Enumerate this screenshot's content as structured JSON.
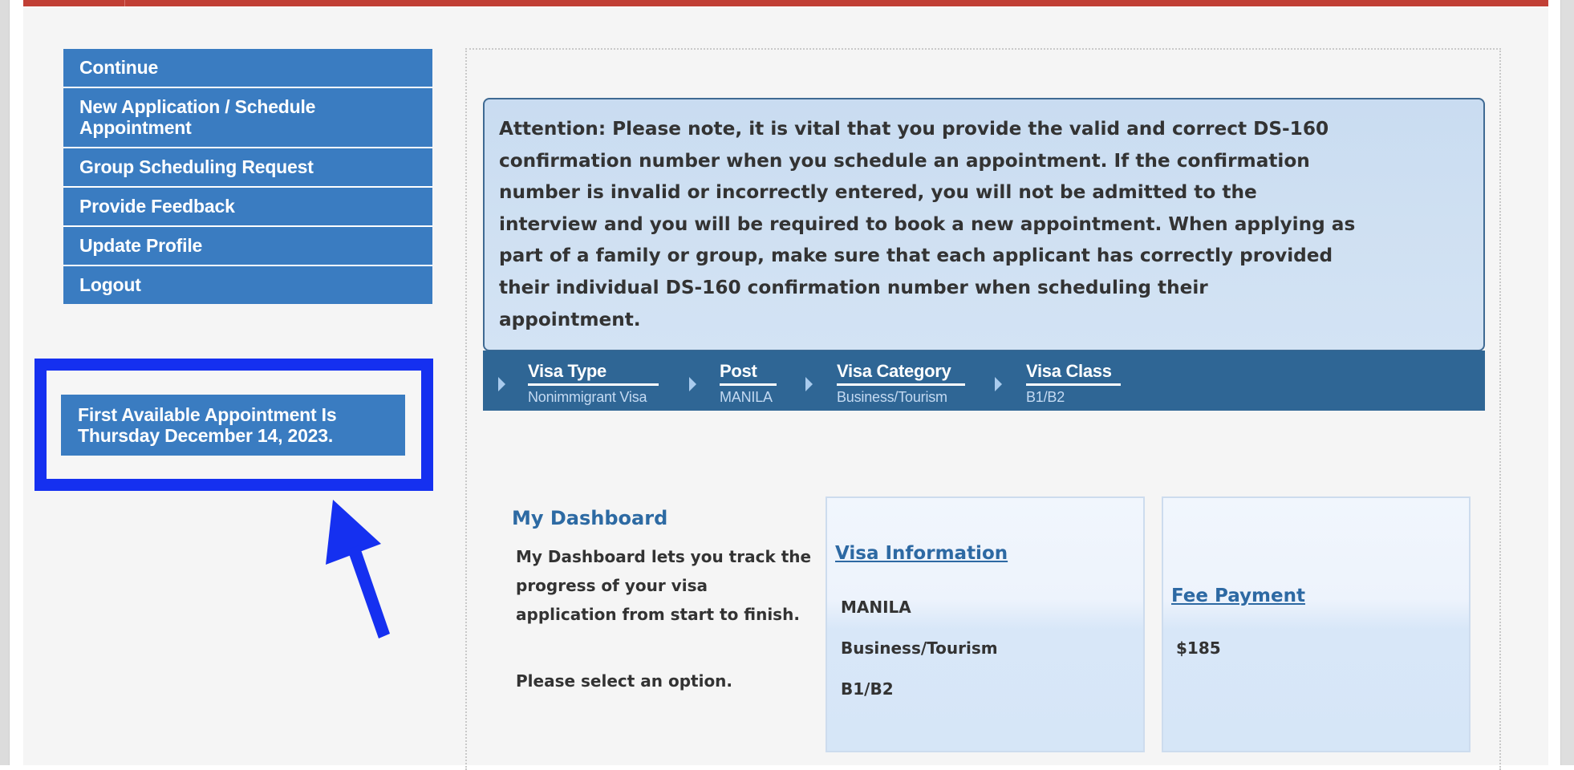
{
  "menu": {
    "items": [
      {
        "label": "Continue"
      },
      {
        "label": "New Application / Schedule Appointment"
      },
      {
        "label": "Group Scheduling Request"
      },
      {
        "label": "Provide Feedback"
      },
      {
        "label": "Update Profile"
      },
      {
        "label": "Logout"
      }
    ]
  },
  "appointment": {
    "line1": "First Available Appointment Is",
    "line2": "Thursday December 14, 2023."
  },
  "annotation": {
    "highlight_color": "#1530f0",
    "arrow_icon": "arrow-up-left-icon"
  },
  "attention": {
    "lines": [
      "Attention: Please note, it is vital that you provide the valid and correct DS-160",
      "confirmation number when you schedule an appointment. If the confirmation",
      "number is invalid or incorrectly entered, you will not be admitted to the",
      "interview and you will be required to book a new appointment. When applying as",
      "part of a family or group, make sure that each applicant has correctly provided",
      "their individual DS-160 confirmation number when scheduling their",
      "appointment."
    ]
  },
  "breadcrumb": [
    {
      "label": "Visa Type",
      "value": "Nonimmigrant Visa"
    },
    {
      "label": "Post",
      "value": "MANILA"
    },
    {
      "label": "Visa Category",
      "value": "Business/Tourism"
    },
    {
      "label": "Visa Class",
      "value": "B1/B2"
    }
  ],
  "dashboard": {
    "title": "My Dashboard",
    "description": "My Dashboard lets you track the progress of your visa application from start to finish.",
    "prompt": "Please select an option."
  },
  "cards": {
    "visa_info": {
      "title": "Visa Information",
      "post": "MANILA",
      "category": "Business/Tourism",
      "class": "B1/B2"
    },
    "fee_payment": {
      "title": "Fee Payment",
      "amount": "$185"
    }
  },
  "colors": {
    "topbar": "#c13f35",
    "menu_bg": "#3a7cc1",
    "breadcrumb_bg": "#2f6695",
    "link": "#2d69a3"
  }
}
